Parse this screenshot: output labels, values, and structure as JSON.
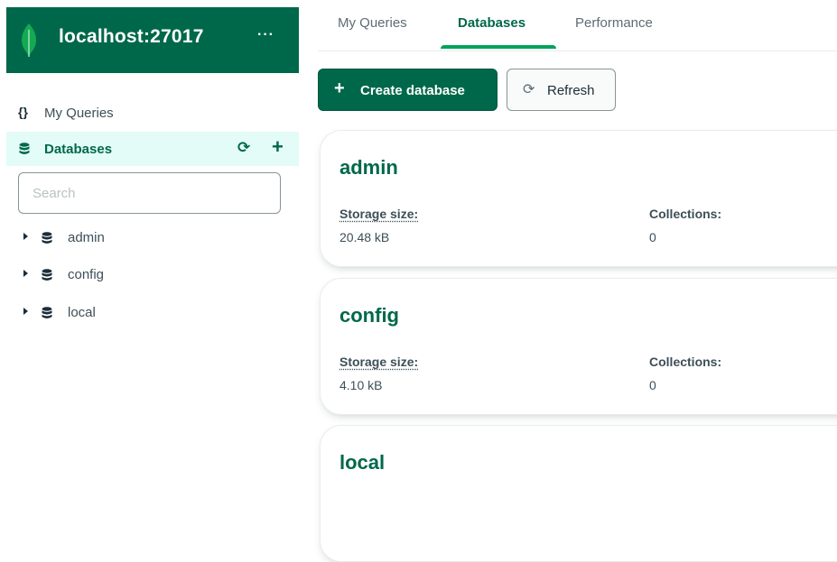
{
  "sidebar": {
    "connection_name": "localhost:27017",
    "menu_label": "···",
    "my_queries_icon": "{}",
    "my_queries_label": "My Queries",
    "databases_label": "Databases",
    "search_placeholder": "Search",
    "tree": [
      {
        "label": "admin"
      },
      {
        "label": "config"
      },
      {
        "label": "local"
      }
    ]
  },
  "tabs": [
    {
      "label": "My Queries"
    },
    {
      "label": "Databases"
    },
    {
      "label": "Performance"
    }
  ],
  "toolbar": {
    "create_label": "Create database",
    "refresh_label": "Refresh"
  },
  "databases": [
    {
      "name": "admin",
      "storage_label": "Storage size:",
      "storage_value": "20.48 kB",
      "collections_label": "Collections:",
      "collections_value": "0"
    },
    {
      "name": "config",
      "storage_label": "Storage size:",
      "storage_value": "4.10 kB",
      "collections_label": "Collections:",
      "collections_value": "0"
    },
    {
      "name": "local"
    }
  ],
  "colors": {
    "brand_dark": "#00684a",
    "brand_accent": "#00a35c",
    "active_nav_bg": "#e3fcf7",
    "leaf_green": "#13aa52"
  },
  "icons": {
    "logo": "mongodb-leaf-icon",
    "database": "database-icon",
    "refresh": "refresh-icon",
    "add": "plus-icon",
    "expand": "caret-right-icon"
  }
}
